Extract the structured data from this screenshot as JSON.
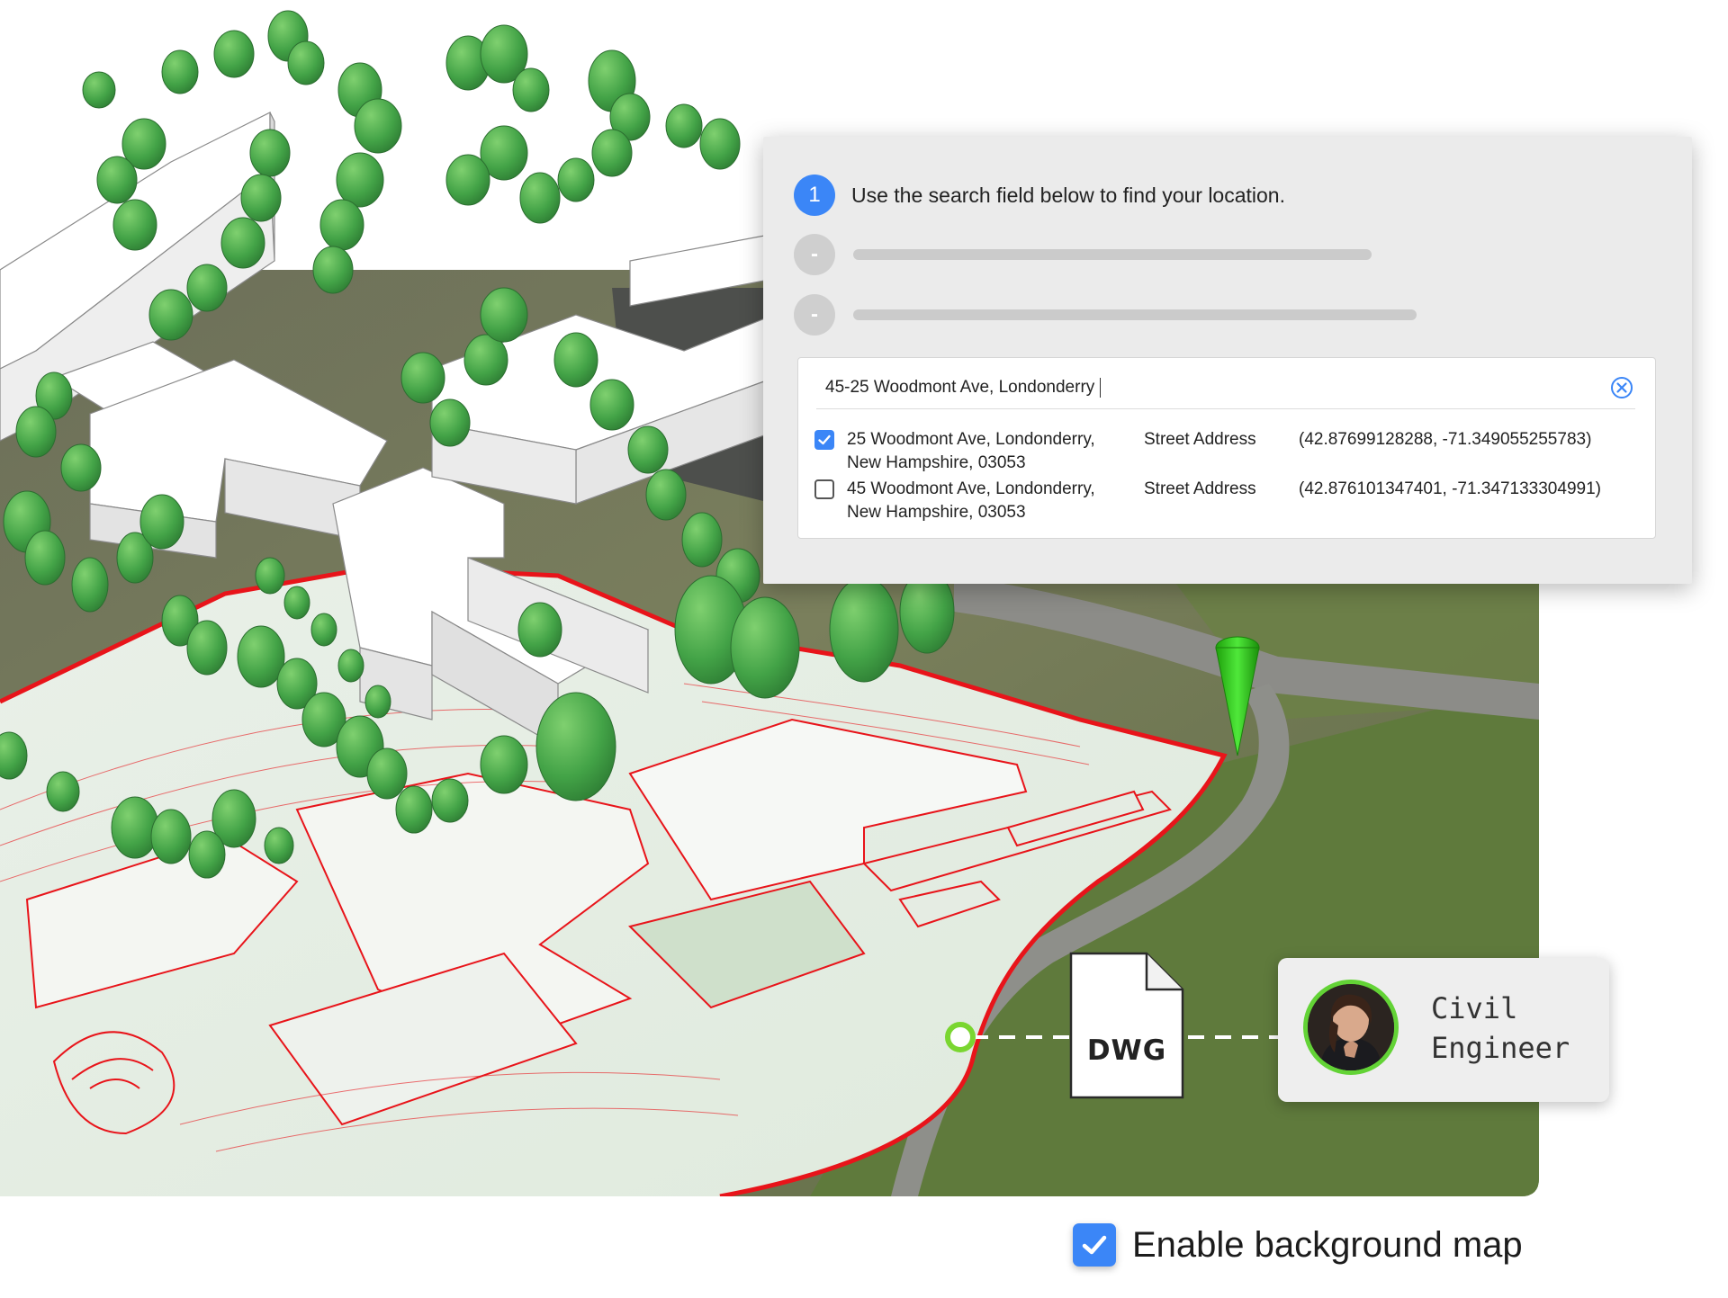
{
  "location_wizard": {
    "step_1": {
      "number": "1",
      "text": "Use the search field below to find your location."
    },
    "step_2": {
      "marker": "-"
    },
    "step_3": {
      "marker": "-"
    },
    "search": {
      "value": "45-25 Woodmont Ave, Londonderry",
      "clear_icon": "clear-circle-icon"
    },
    "results": [
      {
        "checked": true,
        "address_line1": "25 Woodmont Ave, Londonderry,",
        "address_line2": "New Hampshire, 03053",
        "type": "Street Address",
        "coords": "(42.87699128288, -71.349055255783)"
      },
      {
        "checked": false,
        "address_line1": "45 Woodmont Ave, Londonderry,",
        "address_line2": "New Hampshire, 03053",
        "type": "Street Address",
        "coords": "(42.876101347401, -71.347133304991)"
      }
    ]
  },
  "file_badge": {
    "label": "DWG",
    "icon": "document-icon"
  },
  "engineer_card": {
    "label": "Civil\nEngineer",
    "avatar": "person-avatar"
  },
  "background_map": {
    "label": "Enable background map",
    "checked": true
  },
  "colors": {
    "accent": "#3b86f7",
    "site_boundary": "#e8141a",
    "tree_green": "#4caf4f",
    "marker_green": "#33d11d",
    "node_green": "#7ad630"
  }
}
